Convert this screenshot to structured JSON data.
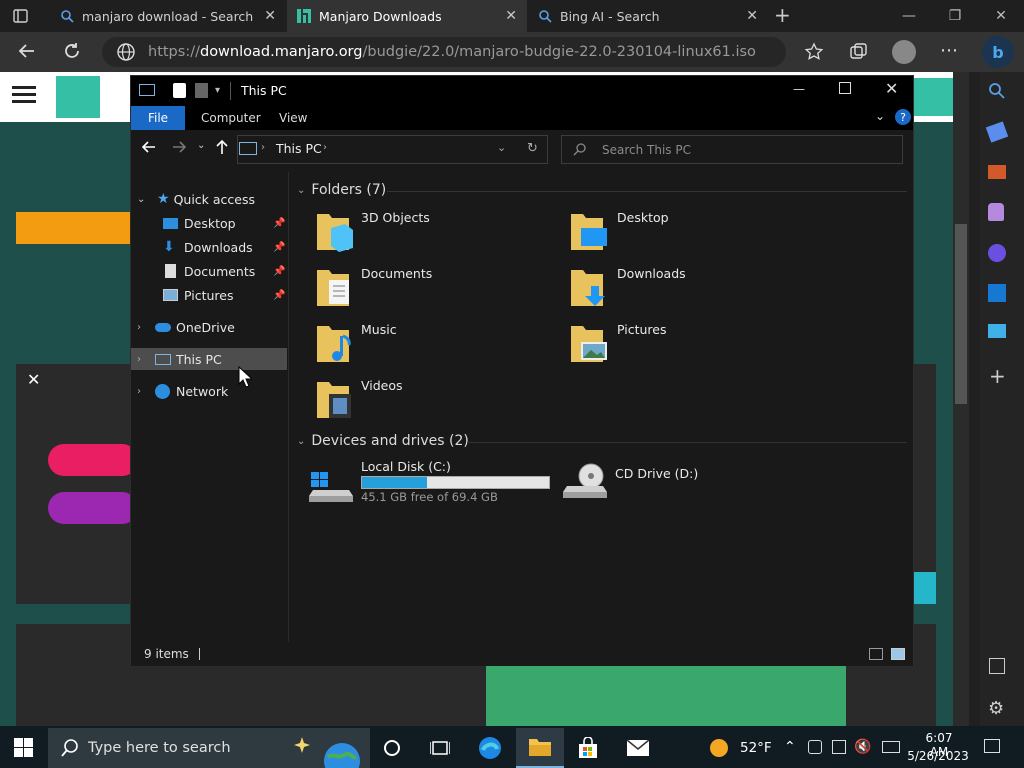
{
  "browser": {
    "tabs": [
      {
        "title": "manjaro download - Search",
        "icon": "search-icon"
      },
      {
        "title": "Manjaro Downloads",
        "icon": "manjaro-logo-icon"
      },
      {
        "title": "Bing AI - Search",
        "icon": "search-icon"
      }
    ],
    "url_prefix": "https://",
    "url_domain": "download.manjaro.org",
    "url_path": "/budgie/22.0/manjaro-budgie-22.0-230104-linux61.iso"
  },
  "explorer": {
    "title": "This PC",
    "ribbon_tabs": [
      "File",
      "Computer",
      "View"
    ],
    "path": "This PC",
    "search_placeholder": "Search This PC",
    "nav": {
      "quick_access": "Quick access",
      "desktop": "Desktop",
      "downloads": "Downloads",
      "documents": "Documents",
      "pictures": "Pictures",
      "onedrive": "OneDrive",
      "this_pc": "This PC",
      "network": "Network"
    },
    "folders_header": "Folders (7)",
    "folders": {
      "f1": "3D Objects",
      "f2": "Desktop",
      "f3": "Documents",
      "f4": "Downloads",
      "f5": "Music",
      "f6": "Pictures",
      "f7": "Videos"
    },
    "drives_header": "Devices and drives (2)",
    "drive_c": {
      "name": "Local Disk (C:)",
      "free": "45.1 GB free of 69.4 GB",
      "used_fraction": 0.35
    },
    "drive_d": {
      "name": "CD Drive (D:)"
    },
    "status": "9 items"
  },
  "taskbar": {
    "search_placeholder": "Type here to search",
    "weather": "52°F",
    "time": "6:07 AM",
    "date": "5/26/2023"
  },
  "colors": {
    "accent": "#1a69c7",
    "drive_bar": "#26a0da",
    "manjaro_green": "#35bfa4"
  }
}
